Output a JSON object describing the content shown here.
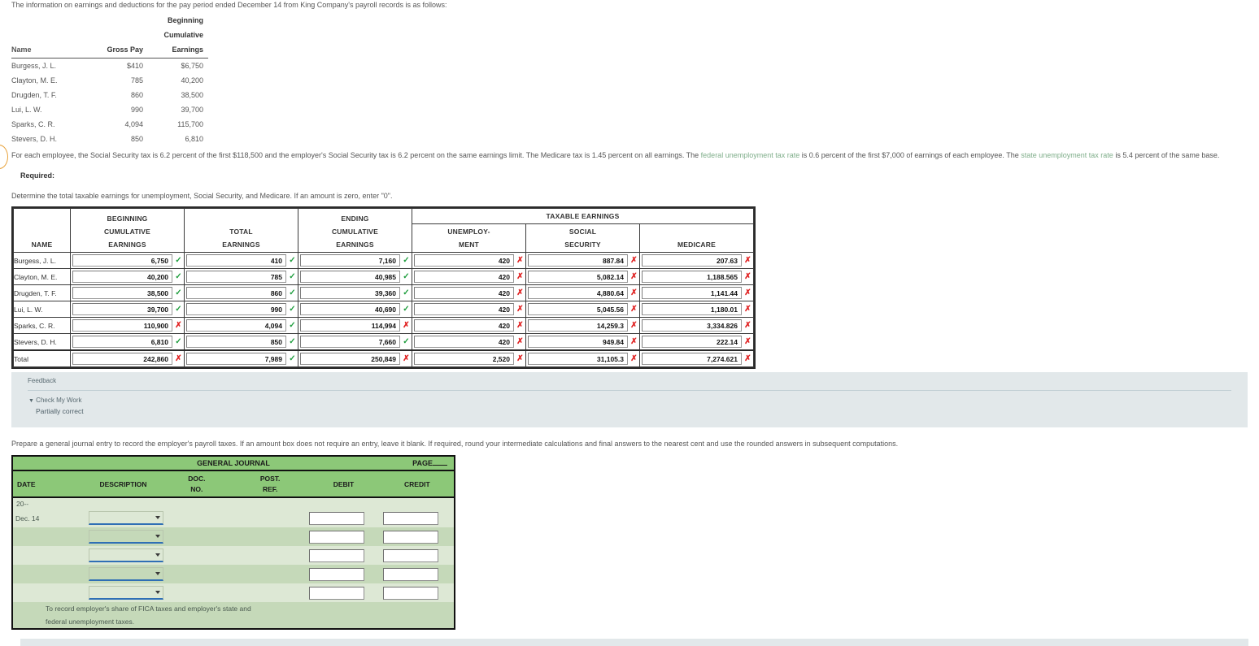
{
  "intro": {
    "text": "The information on earnings and deductions for the pay period ended December 14 from King Company's payroll records is as follows:"
  },
  "records_table": {
    "headers": {
      "name": "Name",
      "gross_pay": "Gross Pay",
      "beginning": "Beginning",
      "cumulative": "Cumulative",
      "earnings": "Earnings"
    },
    "rows": [
      {
        "name": "Burgess, J. L.",
        "gross_pay": "$410",
        "beginning_cumulative_earnings": "$6,750"
      },
      {
        "name": "Clayton, M. E.",
        "gross_pay": "785",
        "beginning_cumulative_earnings": "40,200"
      },
      {
        "name": "Drugden, T. F.",
        "gross_pay": "860",
        "beginning_cumulative_earnings": "38,500"
      },
      {
        "name": "Lui, L. W.",
        "gross_pay": "990",
        "beginning_cumulative_earnings": "39,700"
      },
      {
        "name": "Sparks, C. R.",
        "gross_pay": "4,094",
        "beginning_cumulative_earnings": "115,700"
      },
      {
        "name": "Stevers, D. H.",
        "gross_pay": "850",
        "beginning_cumulative_earnings": "6,810"
      }
    ]
  },
  "tax_paragraph": {
    "part1": "For each employee, the Social Security tax is 6.2 percent of the first $118,500 and the employer's Social Security tax is 6.2 percent on the same earnings limit. The Medicare tax is 1.45 percent on all earnings. The ",
    "link1": "federal unemployment tax rate",
    "part2": " is 0.6 percent of the first $7,000 of earnings of each employee. The ",
    "link2": "state unemployment tax rate",
    "part3": " is 5.4 percent of the same base.",
    "link_color": "#7fae8a"
  },
  "required_label": "Required:",
  "determine_text": "Determine the total taxable earnings for unemployment, Social Security, and Medicare. If an amount is zero, enter \"0\".",
  "taxable_grid": {
    "headers": {
      "name": "NAME",
      "beginning_cumulative_earnings": [
        "BEGINNING",
        "CUMULATIVE",
        "EARNINGS"
      ],
      "total_earnings": [
        "TOTAL",
        "EARNINGS"
      ],
      "ending_cumulative_earnings": [
        "ENDING",
        "CUMULATIVE",
        "EARNINGS"
      ],
      "taxable_earnings": "TAXABLE EARNINGS",
      "unemployment": [
        "UNEMPLOY-",
        "MENT"
      ],
      "social_security": [
        "SOCIAL",
        "SECURITY"
      ],
      "medicare": "MEDICARE"
    },
    "rows": [
      {
        "name": "Burgess, J. L.",
        "begin": "6,750",
        "begin_mark": "check",
        "total": "410",
        "total_mark": "check",
        "ending": "7,160",
        "ending_mark": "check",
        "unemp": "420",
        "unemp_mark": "cross",
        "ss": "887.84",
        "ss_mark": "cross",
        "med": "207.63",
        "med_mark": "cross"
      },
      {
        "name": "Clayton, M. E.",
        "begin": "40,200",
        "begin_mark": "check",
        "total": "785",
        "total_mark": "check",
        "ending": "40,985",
        "ending_mark": "check",
        "unemp": "420",
        "unemp_mark": "cross",
        "ss": "5,082.14",
        "ss_mark": "cross",
        "med": "1,188.565",
        "med_mark": "cross"
      },
      {
        "name": "Drugden, T. F.",
        "begin": "38,500",
        "begin_mark": "check",
        "total": "860",
        "total_mark": "check",
        "ending": "39,360",
        "ending_mark": "check",
        "unemp": "420",
        "unemp_mark": "cross",
        "ss": "4,880.64",
        "ss_mark": "cross",
        "med": "1,141.44",
        "med_mark": "cross"
      },
      {
        "name": "Lui, L. W.",
        "begin": "39,700",
        "begin_mark": "check",
        "total": "990",
        "total_mark": "check",
        "ending": "40,690",
        "ending_mark": "check",
        "unemp": "420",
        "unemp_mark": "cross",
        "ss": "5,045.56",
        "ss_mark": "cross",
        "med": "1,180.01",
        "med_mark": "cross"
      },
      {
        "name": "Sparks, C. R.",
        "begin": "110,900",
        "begin_mark": "cross",
        "total": "4,094",
        "total_mark": "check",
        "ending": "114,994",
        "ending_mark": "cross",
        "unemp": "420",
        "unemp_mark": "cross",
        "ss": "14,259.3",
        "ss_mark": "cross",
        "med": "3,334.826",
        "med_mark": "cross"
      },
      {
        "name": "Stevers, D. H.",
        "begin": "6,810",
        "begin_mark": "check",
        "total": "850",
        "total_mark": "check",
        "ending": "7,660",
        "ending_mark": "check",
        "unemp": "420",
        "unemp_mark": "cross",
        "ss": "949.84",
        "ss_mark": "cross",
        "med": "222.14",
        "med_mark": "cross"
      },
      {
        "name": "Total",
        "begin": "242,860",
        "begin_mark": "cross",
        "total": "7,989",
        "total_mark": "check",
        "ending": "250,849",
        "ending_mark": "cross",
        "unemp": "2,520",
        "unemp_mark": "cross",
        "ss": "31,105.3",
        "ss_mark": "cross",
        "med": "7,274.621",
        "med_mark": "cross"
      }
    ],
    "mark_glyphs": {
      "check": "✓",
      "cross": "✘"
    },
    "mark_colors": {
      "check": "#1f9e3e",
      "cross": "#e02020"
    }
  },
  "feedback": {
    "title": "Feedback",
    "check_my_work": "Check My Work",
    "caret": "▼",
    "status": "Partially correct",
    "background": "#e2e8ea"
  },
  "journal_instruction": "Prepare a general journal entry to record the employer's payroll taxes. If an amount box does not require an entry, leave it blank. If required, round your intermediate calculations and final answers to the nearest cent and use the rounded answers in subsequent computations.",
  "journal": {
    "title": "GENERAL JOURNAL",
    "page_label": "PAGE",
    "page_value": "",
    "headers": {
      "date": "DATE",
      "description": "DESCRIPTION",
      "doc_no": [
        "DOC.",
        "NO."
      ],
      "post_ref": [
        "POST.",
        "REF."
      ],
      "debit": "DEBIT",
      "credit": "CREDIT"
    },
    "year_label": "20--",
    "rows": [
      {
        "date": "Dec. 14",
        "description_value": "",
        "doc_no": "",
        "post_ref": "",
        "debit": "",
        "credit": ""
      },
      {
        "date": "",
        "description_value": "",
        "doc_no": "",
        "post_ref": "",
        "debit": "",
        "credit": ""
      },
      {
        "date": "",
        "description_value": "",
        "doc_no": "",
        "post_ref": "",
        "debit": "",
        "credit": ""
      },
      {
        "date": "",
        "description_value": "",
        "doc_no": "",
        "post_ref": "",
        "debit": "",
        "credit": ""
      },
      {
        "date": "",
        "description_value": "",
        "doc_no": "",
        "post_ref": "",
        "debit": "",
        "credit": ""
      }
    ],
    "memo_line1": "To record employer's share of FICA taxes and employer's state and",
    "memo_line2": "federal unemployment taxes.",
    "header_color": "#8cc878",
    "row_light": "#dde8d5",
    "row_dark": "#c5d9b9"
  }
}
